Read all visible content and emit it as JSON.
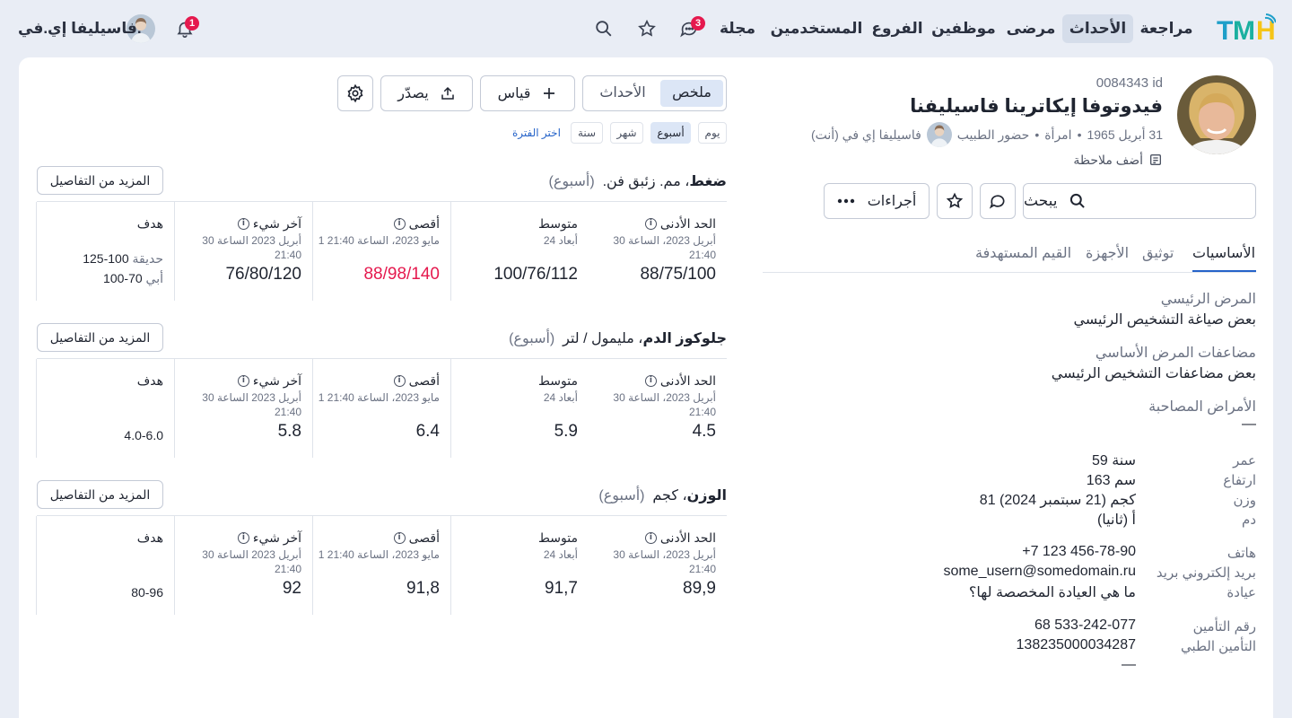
{
  "app": {
    "logo_text": "TMH",
    "nav": [
      {
        "label": "مراجعة"
      },
      {
        "label": "الأحداث",
        "active": true
      },
      {
        "label": "مرضى"
      },
      {
        "label": "موظفين"
      },
      {
        "label": "الفروع"
      },
      {
        "label": "المستخدمين"
      },
      {
        "label": "مجلة"
      }
    ],
    "chat_badge": "3",
    "notif_badge": "1",
    "user_name": "فاسيليفا إي.في."
  },
  "patient": {
    "id": "0084343 id",
    "name": "فيدوتوفا إيكاترينا فاسيليفنا",
    "birth": "31 أبريل 1965",
    "sex": "امرأة",
    "attendance": "حضور الطبيب",
    "doctor": "فاسيليفا إي في (أنت)",
    "add_note": "أضف ملاحظة",
    "search_placeholder": "يبحث",
    "actions_label": "أجراءات",
    "tabs": [
      "الأساسيات",
      "توثيق",
      "الأجهزة",
      "القيم المستهدفة"
    ],
    "main_disease_label": "المرض الرئيسي",
    "main_disease_value": "بعض صياغة التشخيص الرئيسي",
    "complications_label": "مضاعفات المرض الأساسي",
    "complications_value": "بعض مضاعفات التشخيص الرئيسي",
    "comorbid_label": "الأمراض المصاحبة",
    "comorbid_value": "—",
    "age_label": "عمر",
    "age_value": "59 سنة",
    "height_label": "ارتفاع",
    "height_value": "163 سم",
    "weight_label": "وزن",
    "weight_value": "81 كجم (21 سبتمبر 2024)",
    "blood_label": "دم",
    "blood_value": "أ (ثانيا)",
    "phone_label": "هاتف",
    "phone_value": "+7 123 456-78-90",
    "email_label": "بريد إلكتروني بريد",
    "email_value": "some_usern@somedomain.ru",
    "clinic_label": "عيادة",
    "clinic_value": "ما هي العيادة المخصصة لها؟",
    "insurance_label": "رقم التأمين",
    "insurance_value": "68 533-242-077",
    "medical_insurance_label": "التأمين الطبي",
    "medical_insurance_value": "138235000034287",
    "medical_insurance_extra": "—"
  },
  "dashboard": {
    "view_summary": "ملخص",
    "view_events": "الأحداث",
    "measure_button": "قياس",
    "export_button": "يصدّر",
    "periods": [
      "يوم",
      "أسبوع",
      "شهر",
      "سنة"
    ],
    "active_period": "أسبوع",
    "choose_period": "اختر الفترة",
    "more_details": "المزيد من التفاصيل",
    "metrics": [
      {
        "name": "ضغط",
        "unit": "، مم. زئبق فن.",
        "period": "(أسبوع)",
        "min_label": "الحد الأدنى",
        "min_date": "30 أبريل 2023، الساعة 21:40",
        "min_value": "88/75/100",
        "avg_label": "متوسط",
        "avg_date": "24 أبعاد",
        "avg_value": "100/76/112",
        "max_label": "أقصى",
        "max_date": "1 مايو 2023، الساعة 21:40",
        "max_value": "88/98/140",
        "last_label": "آخر شيء",
        "last_date": "30 أبريل 2023 الساعة 21:40",
        "last_value": "76/80/120",
        "target_label": "هدف",
        "target_line1_label": "حديقة",
        "target_line1_value": "100-125",
        "target_line2_label": "أبي",
        "target_line2_value": "70-100"
      },
      {
        "name": "جلوكوز الدم",
        "unit": "، مليمول / لتر",
        "period": "(أسبوع)",
        "min_label": "الحد الأدنى",
        "min_date": "30 أبريل 2023، الساعة 21:40",
        "min_value": "4.5",
        "avg_label": "متوسط",
        "avg_date": "24 أبعاد",
        "avg_value": "5.9",
        "max_label": "أقصى",
        "max_date": "1 مايو 2023، الساعة 21:40",
        "max_value": "6.4",
        "last_label": "آخر شيء",
        "last_date": "30 أبريل 2023 الساعة 21:40",
        "last_value": "5.8",
        "target_label": "هدف",
        "target_value": "4.0-6.0"
      },
      {
        "name": "الوزن",
        "unit": "، كجم",
        "period": "(أسبوع)",
        "min_label": "الحد الأدنى",
        "min_date": "30 أبريل 2023، الساعة 21:40",
        "min_value": "89,9",
        "avg_label": "متوسط",
        "avg_date": "24 أبعاد",
        "avg_value": "91,7",
        "max_label": "أقصى",
        "max_date": "1 مايو 2023، الساعة 21:40",
        "max_value": "91,8",
        "last_label": "آخر شيء",
        "last_date": "30 أبريل 2023 الساعة 21:40",
        "last_value": "92",
        "target_label": "هدف",
        "target_value": "80-96"
      }
    ]
  },
  "colors": {
    "accent": "#2563c9",
    "alert": "#e5194e",
    "background": "#e9edf5"
  }
}
